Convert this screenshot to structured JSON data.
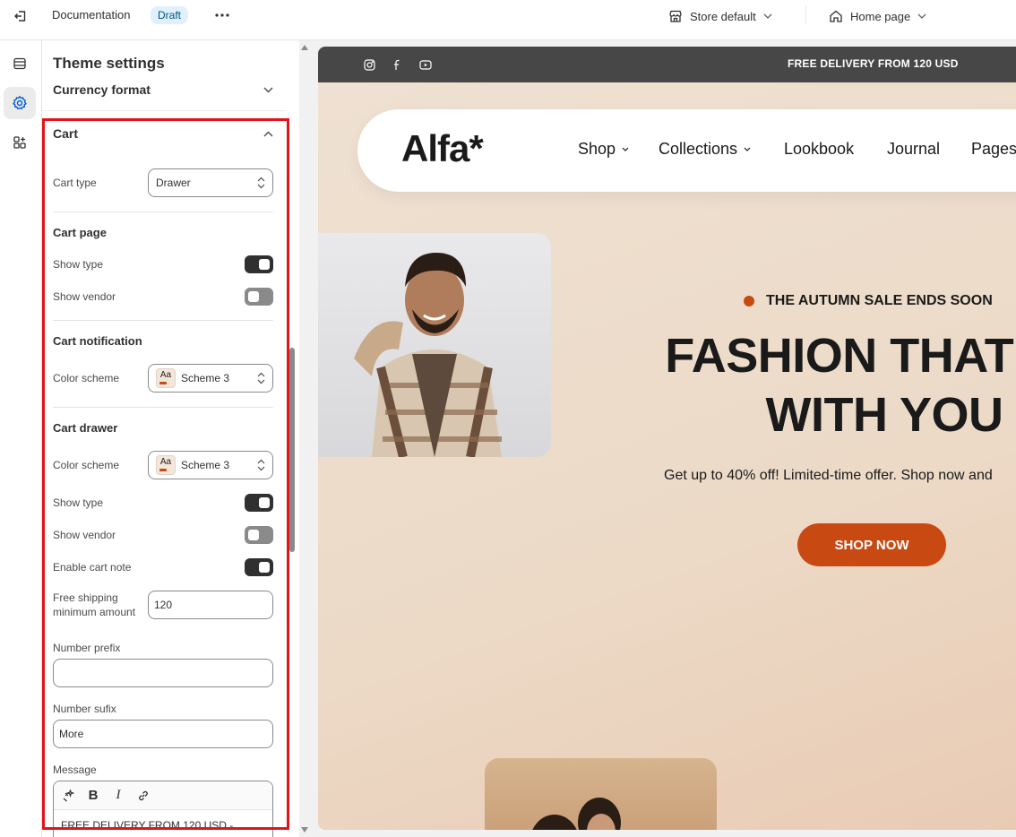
{
  "topbar": {
    "title": "Documentation",
    "status_badge": "Draft",
    "store_selector": "Store default",
    "page_selector": "Home page"
  },
  "icons": {
    "exit": "exit-icon",
    "more": "more-horizontal-icon",
    "store": "store-icon",
    "home": "home-icon",
    "sections": "sections-icon",
    "settings": "gear-icon",
    "apps": "apps-icon"
  },
  "panel": {
    "title": "Theme settings",
    "collapsed_section": "Currency format",
    "section": "Cart",
    "cart_type": {
      "label": "Cart type",
      "value": "Drawer"
    },
    "cart_page": {
      "heading": "Cart page",
      "show_type": {
        "label": "Show type",
        "on": true
      },
      "show_vendor": {
        "label": "Show vendor",
        "on": false
      }
    },
    "cart_notification": {
      "heading": "Cart notification",
      "color_scheme": {
        "label": "Color scheme",
        "value": "Scheme 3",
        "swatch_text": "Aa"
      }
    },
    "cart_drawer": {
      "heading": "Cart drawer",
      "color_scheme": {
        "label": "Color scheme",
        "value": "Scheme 3",
        "swatch_text": "Aa"
      },
      "show_type": {
        "label": "Show type",
        "on": true
      },
      "show_vendor": {
        "label": "Show vendor",
        "on": false
      },
      "enable_cart_note": {
        "label": "Enable cart note",
        "on": true
      },
      "free_shipping": {
        "label_line1": "Free shipping",
        "label_line2": "minimum amount",
        "value": "120"
      },
      "number_prefix": {
        "label": "Number prefix",
        "value": ""
      },
      "number_suffix": {
        "label": "Number sufix",
        "value": "More"
      },
      "message": {
        "label": "Message",
        "value": "FREE DELIVERY FROM 120 USD -"
      }
    }
  },
  "preview": {
    "announcement": "FREE DELIVERY FROM 120 USD",
    "logo": "Alfa*",
    "nav": [
      "Shop",
      "Collections",
      "Lookbook",
      "Journal",
      "Pages"
    ],
    "sale_label": "THE AUTUMN SALE ENDS SOON",
    "headline_line1": "FASHION THAT MO",
    "headline_line2": "WITH YOU",
    "subtext": "Get up to 40% off! Limited-time offer. Shop now and",
    "cta": "SHOP NOW"
  },
  "colors": {
    "accent": "#c84a12",
    "highlight": "#e4131b",
    "announcement_bg": "#474747"
  }
}
